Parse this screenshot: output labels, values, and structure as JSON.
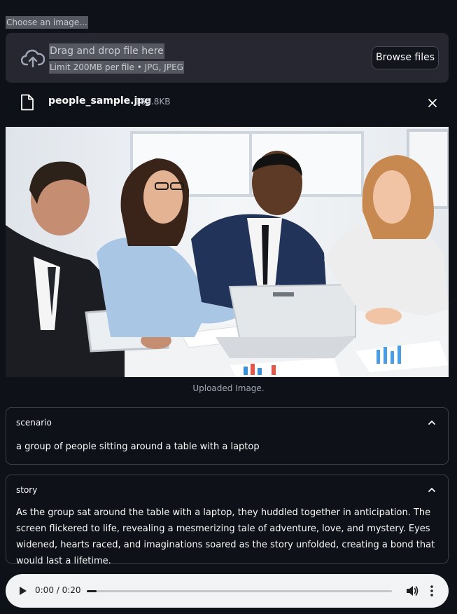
{
  "uploader": {
    "label": "Choose an image...",
    "drop_title": "Drag and drop file here",
    "drop_hint": "Limit 200MB per file • JPG, JPEG",
    "browse_label": "Browse files",
    "cloud_icon": "cloud-upload-icon"
  },
  "file": {
    "name": "people_sample.jpg",
    "size": "165.8KB",
    "icon": "file-icon",
    "remove_icon": "close-icon"
  },
  "image": {
    "caption": "Uploaded Image."
  },
  "expanders": [
    {
      "title": "scenario",
      "text": "a group of people sitting around a table with a laptop"
    },
    {
      "title": "story",
      "text": "As the group sat around the table with a laptop, they huddled together in anticipation. The screen flickered to life, revealing a mesmerizing tale of adventure, love, and mystery. Eyes widened, hearts raced, and imaginations soared as the story unfolded, creating a bond that would last a lifetime."
    }
  ],
  "audio": {
    "time": "0:00 / 0:20",
    "progress": 0.0
  },
  "colors": {
    "background": "#0e1117",
    "panel": "#262730",
    "border": "#3d3f47",
    "player": "#f1f3f4"
  }
}
